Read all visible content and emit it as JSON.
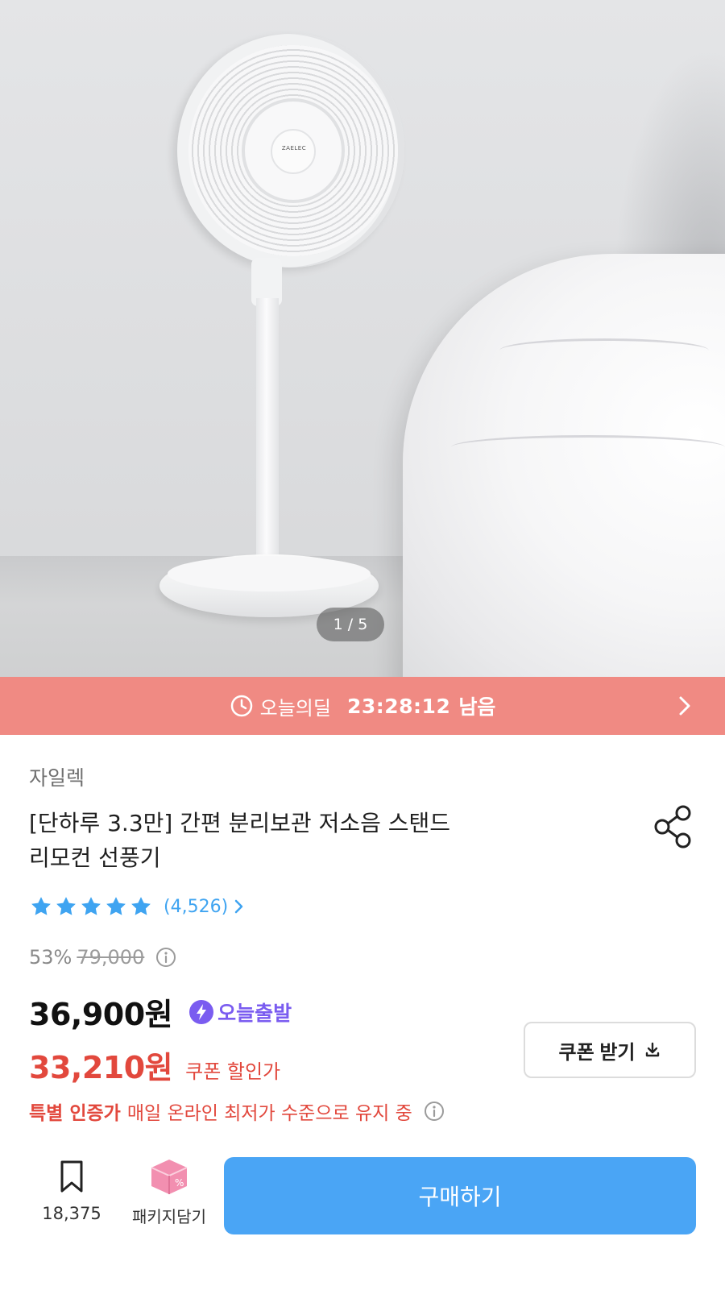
{
  "hero": {
    "image_alt": "White stand fan next to a bed",
    "fan_brand_text": "ZAELEC",
    "page_counter": "1 / 5"
  },
  "deal_banner": {
    "icon": "clock-icon",
    "label": "오늘의딜",
    "timer": "23:28:12",
    "suffix": "남음",
    "color": "#f08a83"
  },
  "product": {
    "brand": "자일렉",
    "title_line1": "[단하루 3.3만] 간편 분리보관 저소음 스탠드",
    "title_line2": "리모컨 선풍기",
    "rating_stars": 5,
    "review_count": "(4,526)",
    "discount_rate": "53%",
    "original_price": "79,000",
    "price": "36,900원",
    "delivery_badge": "오늘출발",
    "coupon_price": "33,210원",
    "coupon_price_label": "쿠폰 할인가",
    "coupon_button": "쿠폰 받기",
    "special_strong": "특별 인증가",
    "special_text": "매일 온라인 최저가 수준으로 유지 중"
  },
  "bottom_bar": {
    "bookmark_count": "18,375",
    "package_label": "패키지담기",
    "buy_button": "구매하기"
  },
  "colors": {
    "accent_blue": "#4aa5f5",
    "star_blue": "#3fa4f1",
    "sale_red": "#e2483d",
    "delivery_purple": "#7a5cf0",
    "package_pink": "#f28fb0"
  }
}
